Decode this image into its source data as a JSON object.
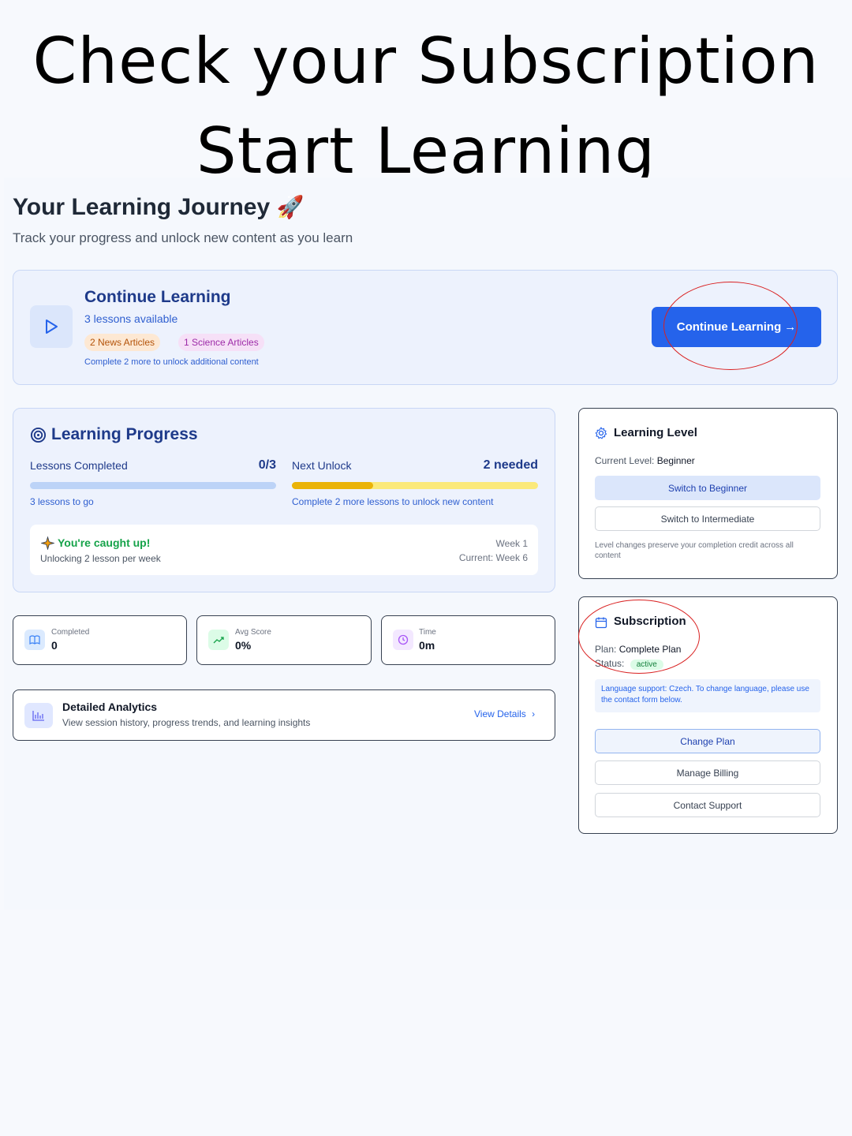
{
  "headline": {
    "line1": "Check your Subscription",
    "line2": "Start Learning"
  },
  "journey": {
    "title": "Your Learning Journey",
    "emoji": "🚀",
    "subtitle": "Track your progress and unlock new content as you learn"
  },
  "continue_card": {
    "title": "Continue Learning",
    "lessons_available": "3 lessons available",
    "pill_news": "2 News Articles",
    "pill_science": "1 Science Articles",
    "note": "Complete 2 more to unlock additional content",
    "button_label": "Continue Learning",
    "button_arrow": "→"
  },
  "progress": {
    "title": "Learning Progress",
    "lessons_completed_label": "Lessons Completed",
    "lessons_completed_value": "0/3",
    "lessons_completed_fraction": 0,
    "lessons_to_go": "3 lessons to go",
    "next_unlock_label": "Next Unlock",
    "next_unlock_value": "2 needed",
    "next_unlock_fraction": 0.33,
    "next_unlock_note": "Complete 2 more lessons to unlock new content",
    "caught_up_title": "You're caught up!",
    "caught_up_sub": "Unlocking 2 lesson per week",
    "week_label": "Week 1",
    "current_week": "Current: Week 6"
  },
  "stats": [
    {
      "label": "Completed",
      "value": "0",
      "icon": "book-icon"
    },
    {
      "label": "Avg Score",
      "value": "0%",
      "icon": "trend-up-icon"
    },
    {
      "label": "Time",
      "value": "0m",
      "icon": "clock-icon"
    }
  ],
  "analytics": {
    "title": "Detailed Analytics",
    "subtitle": "View session history, progress trends, and learning insights",
    "link": "View Details",
    "link_chevron": "›"
  },
  "level": {
    "title": "Learning Level",
    "current_label": "Current Level:",
    "current_value": "Beginner",
    "btn_beginner": "Switch to Beginner",
    "btn_intermediate": "Switch to Intermediate",
    "note": "Level changes preserve your completion credit across all content"
  },
  "subscription": {
    "title": "Subscription",
    "plan_label": "Plan:",
    "plan_value": "Complete Plan",
    "status_label": "Status:",
    "status_value": "active",
    "language_note": "Language support: Czech. To change language, please use the contact form below.",
    "btn_change": "Change Plan",
    "btn_billing": "Manage Billing",
    "btn_support": "Contact Support"
  },
  "colors": {
    "primary": "#2563eb",
    "heading_blue": "#1e3a8a",
    "progress_yellow": "#facc15",
    "progress_orange": "#eab308",
    "success_green": "#16a34a",
    "annotation_red": "#d92020"
  }
}
